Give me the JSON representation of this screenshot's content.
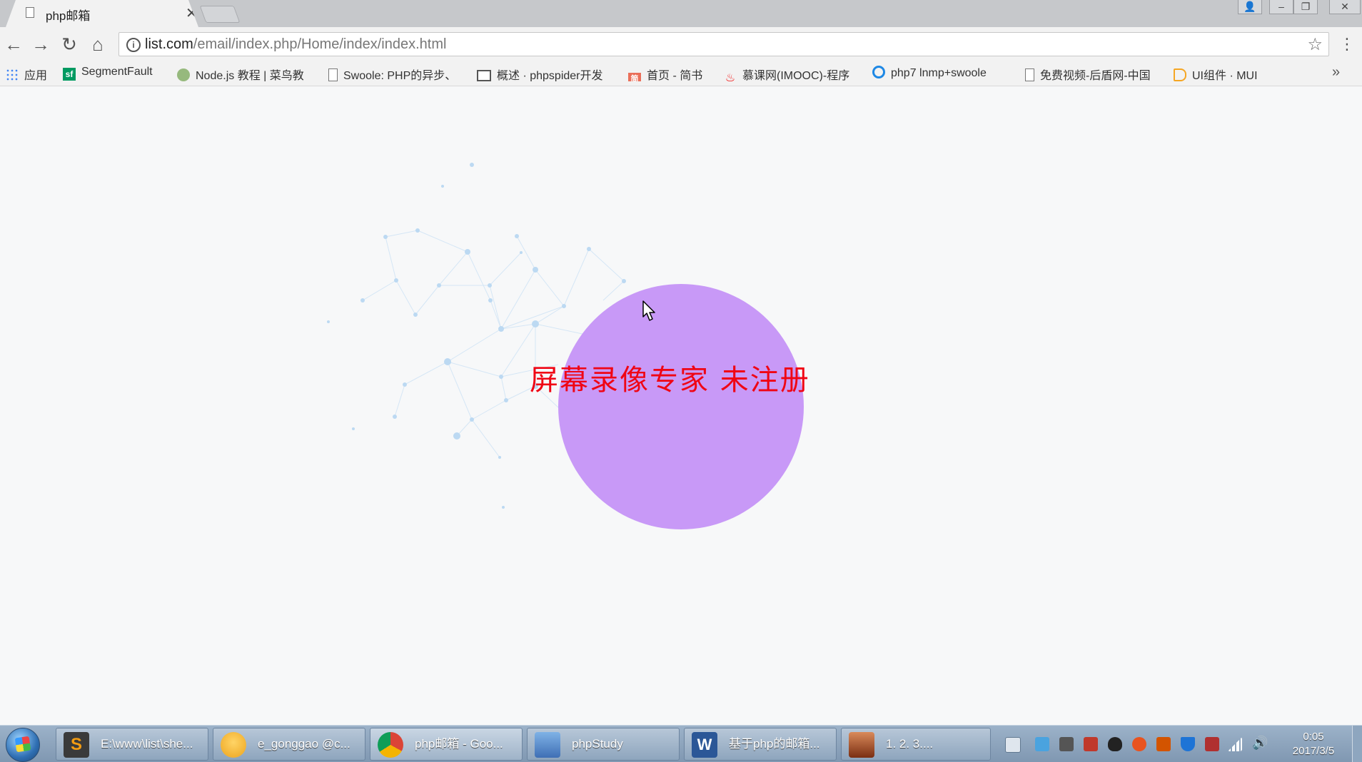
{
  "browser": {
    "tab": {
      "title": "php邮箱",
      "close_label": "✕"
    },
    "window_controls": [
      "👤",
      "–",
      "❐",
      "✕"
    ],
    "nav": {
      "back": "←",
      "forward": "→",
      "reload": "↻",
      "home": "⌂"
    },
    "address": {
      "host": "list.com",
      "path": "/email/index.php/Home/index/index.html",
      "info": "i"
    },
    "star": "☆",
    "menu": "⋮",
    "bookmarks": [
      {
        "label": "应用",
        "icon": "apps-icon",
        "color": "#4285f4"
      },
      {
        "label": "SegmentFault",
        "icon": "segmentfault-icon",
        "color": "#009a61"
      },
      {
        "label": "Node.js 教程 | 菜鸟教",
        "icon": "runoob-icon",
        "color": "#96b97d"
      },
      {
        "label": "Swoole: PHP的异步、",
        "icon": "page-icon",
        "color": "#777777"
      },
      {
        "label": "概述 · phpspider开发",
        "icon": "book-icon",
        "color": "#555555"
      },
      {
        "label": "首页 - 简书",
        "icon": "jianshu-icon",
        "color": "#ea6f5a"
      },
      {
        "label": "慕课网(IMOOC)-程序",
        "icon": "imooc-flame-icon",
        "color": "#f01414"
      },
      {
        "label": "php7 lnmp+swoole",
        "icon": "ring-icon",
        "color": "#1e88e5"
      },
      {
        "label": "免费视频-后盾网-中国",
        "icon": "page-icon",
        "color": "#777777"
      },
      {
        "label": "UI组件 · MUI",
        "icon": "mui-tag-icon",
        "color": "#f5a623"
      }
    ],
    "bookmarks_more": "»"
  },
  "page": {
    "watermark": "屏幕录像专家  未注册",
    "circle_color": "#c899f7",
    "watermark_color": "#f00514"
  },
  "taskbar": {
    "items": [
      {
        "label": "E:\\www\\list\\she...",
        "icon": "sublime-text-icon",
        "color": "#3a3a3a"
      },
      {
        "label": "e_gonggao @c...",
        "icon": "database-tool-icon",
        "color": "#f2b233"
      },
      {
        "label": "php邮箱 - Goo...",
        "icon": "chrome-icon",
        "color": "#db4437"
      },
      {
        "label": "phpStudy",
        "icon": "phpstudy-icon",
        "color": "#3f6fb5"
      },
      {
        "label": "基于php的邮箱...",
        "icon": "word-icon",
        "color": "#2b5797"
      },
      {
        "label": "1. 2. 3....",
        "icon": "recorder-avatar-icon",
        "color": "#b5562d"
      }
    ],
    "tray": [
      "keyboard-icon",
      "network-app-icon",
      "tool-icon",
      "antivirus-icon",
      "qq-icon",
      "weibo-icon",
      "app-icon",
      "shield-icon",
      "security-icon",
      "signal-icon",
      "volume-icon"
    ],
    "clock": {
      "time": "0:05",
      "date": "2017/3/5"
    }
  }
}
